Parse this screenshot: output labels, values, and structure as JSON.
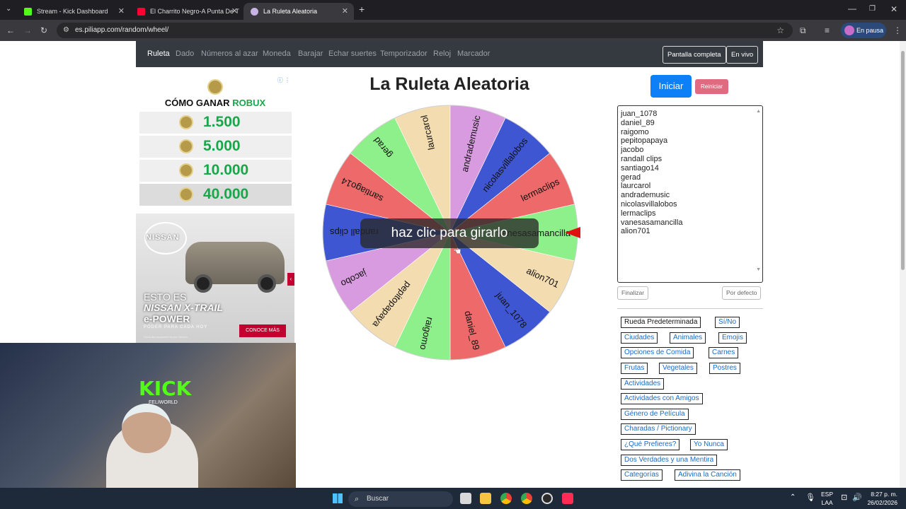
{
  "browser": {
    "tabs": [
      {
        "title": "Stream - Kick Dashboard",
        "favicon_color": "#53fc18"
      },
      {
        "title": "El Charrito Negro-A Punta De T",
        "favicon_color": "#ff0033"
      },
      {
        "title": "La Ruleta Aleatoria",
        "favicon_color": "#c7b3e6"
      }
    ],
    "new_tab": "+",
    "url": "es.piliapp.com/random/wheel/",
    "profile_status": "En pausa"
  },
  "nav": {
    "items": [
      "Ruleta",
      "Dado",
      "Números al azar",
      "Moneda",
      "Barajar",
      "Echar suertes",
      "Temporizador",
      "Reloj",
      "Marcador"
    ],
    "fullscreen": "Pantalla completa",
    "live": "En vivo"
  },
  "main": {
    "title": "La Ruleta Aleatoria",
    "start": "Iniciar",
    "reset": "Reiniciar",
    "wheel_overlay": "haz clic para girarlo",
    "names": [
      "juan_1078",
      "daniel_89",
      "raigomo",
      "pepitopapaya",
      "jacobo",
      "randall clips",
      "santiago14",
      "gerad",
      "laurcarol",
      "andrademusic",
      "nicolasvillalobos",
      "lermaclips",
      "vanesasamancilla",
      "alion701"
    ],
    "finish": "Finalizar",
    "default": "Por defecto"
  },
  "wheel": {
    "segments": [
      {
        "label": "juan_1078",
        "color": "#3f56d3"
      },
      {
        "label": "daniel_89",
        "color": "#ee6a6a"
      },
      {
        "label": "raigomo",
        "color": "#8ef08a"
      },
      {
        "label": "pepitopapaya",
        "color": "#f3dcb0"
      },
      {
        "label": "jacobo",
        "color": "#d99be0"
      },
      {
        "label": "randall clips",
        "color": "#3f56d3"
      },
      {
        "label": "santiago14",
        "color": "#ee6a6a"
      },
      {
        "label": "gerad",
        "color": "#8ef08a"
      },
      {
        "label": "laurcarol",
        "color": "#f3dcb0"
      },
      {
        "label": "andrademusic",
        "color": "#d99be0"
      },
      {
        "label": "nicolasvillalobos",
        "color": "#3f56d3"
      },
      {
        "label": "lermaclips",
        "color": "#ee6a6a"
      },
      {
        "label": "vanesasamancilla",
        "color": "#8ef08a"
      },
      {
        "label": "alion701",
        "color": "#f3dcb0"
      }
    ],
    "pointer_color": "#e01010"
  },
  "presets": [
    "Rueda Predeterminada",
    "Sí/No",
    "Ciudades",
    "Animales",
    "Emojis",
    "Opciones de Comida",
    "Carnes",
    "Frutas",
    "Vegetales",
    "Postres",
    "Actividades",
    "Actividades con Amigos",
    "Género de Película",
    "Charadas / Pictionary",
    "¿Qué Prefieres?",
    "Yo Nunca",
    "Dos Verdades y una Mentira",
    "Categorías",
    "Adivina la Canción"
  ],
  "ads": {
    "robux_title_a": "CÓMO GANAR ",
    "robux_title_b": "ROBUX",
    "robux_amounts": [
      "1.500",
      "5.000",
      "10.000",
      "40.000"
    ],
    "nissan_brand": "NISSAN",
    "nissan_line1": "ESTO ES",
    "nissan_line2": "NISSAN X-TRAIL",
    "nissan_line3": "e-POWER",
    "nissan_tagline": "PODER PARA CADA HOY",
    "nissan_cta": "CONOCE MÁS",
    "nissan_fine": "Consulta equipamiento por versión"
  },
  "webcam": {
    "sign_text": "KICK",
    "sign_sub": "FELIWORLD"
  },
  "taskbar": {
    "search": "Buscar",
    "lang1": "ESP",
    "lang2": "LAA",
    "time": "8:27 p. m.",
    "date": "26/02/2026"
  }
}
